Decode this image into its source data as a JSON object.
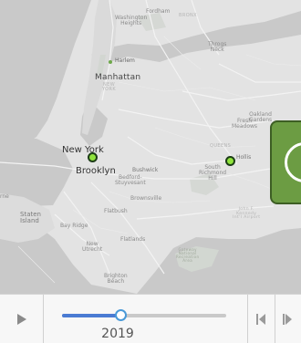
{
  "map": {
    "labels": {
      "fordham": "Fordham",
      "bronx_faint": "BRONX",
      "washington_heights": "Washington\nHeights",
      "throgs_neck": "Throgs\nNeck",
      "harlem": "Harlem",
      "manhattan": "Manhattan",
      "new_york_faint": "NEW\nYORK",
      "oakland_gardens": "Oakland\nGardens",
      "fresh_meadows": "Fresh\nMeadows",
      "queens_faint": "QUEENS",
      "new_york": "New York",
      "brooklyn": "Brooklyn",
      "bushwick": "Bushwick",
      "bedford_stuyvesant": "Bedford-\nStuyvesant",
      "hollis": "Hollis",
      "south_richmond_hill": "South\nRichmond\nHill",
      "brownsville": "Brownsville",
      "flatbush": "Flatbush",
      "jfk": "John F.\nKennedy\nInt'l Airport",
      "staten_island": "Staten\nIsland",
      "bay_ridge": "Bay Ridge",
      "flatlands": "Flatlands",
      "new_utrecht": "New\nUtrecht",
      "gateway": "Gateway\nNational\nRecreation\nArea",
      "brighton_beach": "Brighton\nBeach",
      "rne": "rne"
    },
    "colors": {
      "water": "#c9c9c9",
      "land": "#e3e3e3",
      "park": "#d5d8d4",
      "marker_fill": "#8fe33c",
      "marker_stroke": "#1d3d17",
      "cluster_fill": "#6c9c43"
    }
  },
  "controls": {
    "year": "2019",
    "play_icon": "play-icon",
    "prev_icon": "step-back-icon",
    "next_icon": "step-forward-icon",
    "slider_progress": 0.36,
    "accent": "#4a7bd3"
  }
}
